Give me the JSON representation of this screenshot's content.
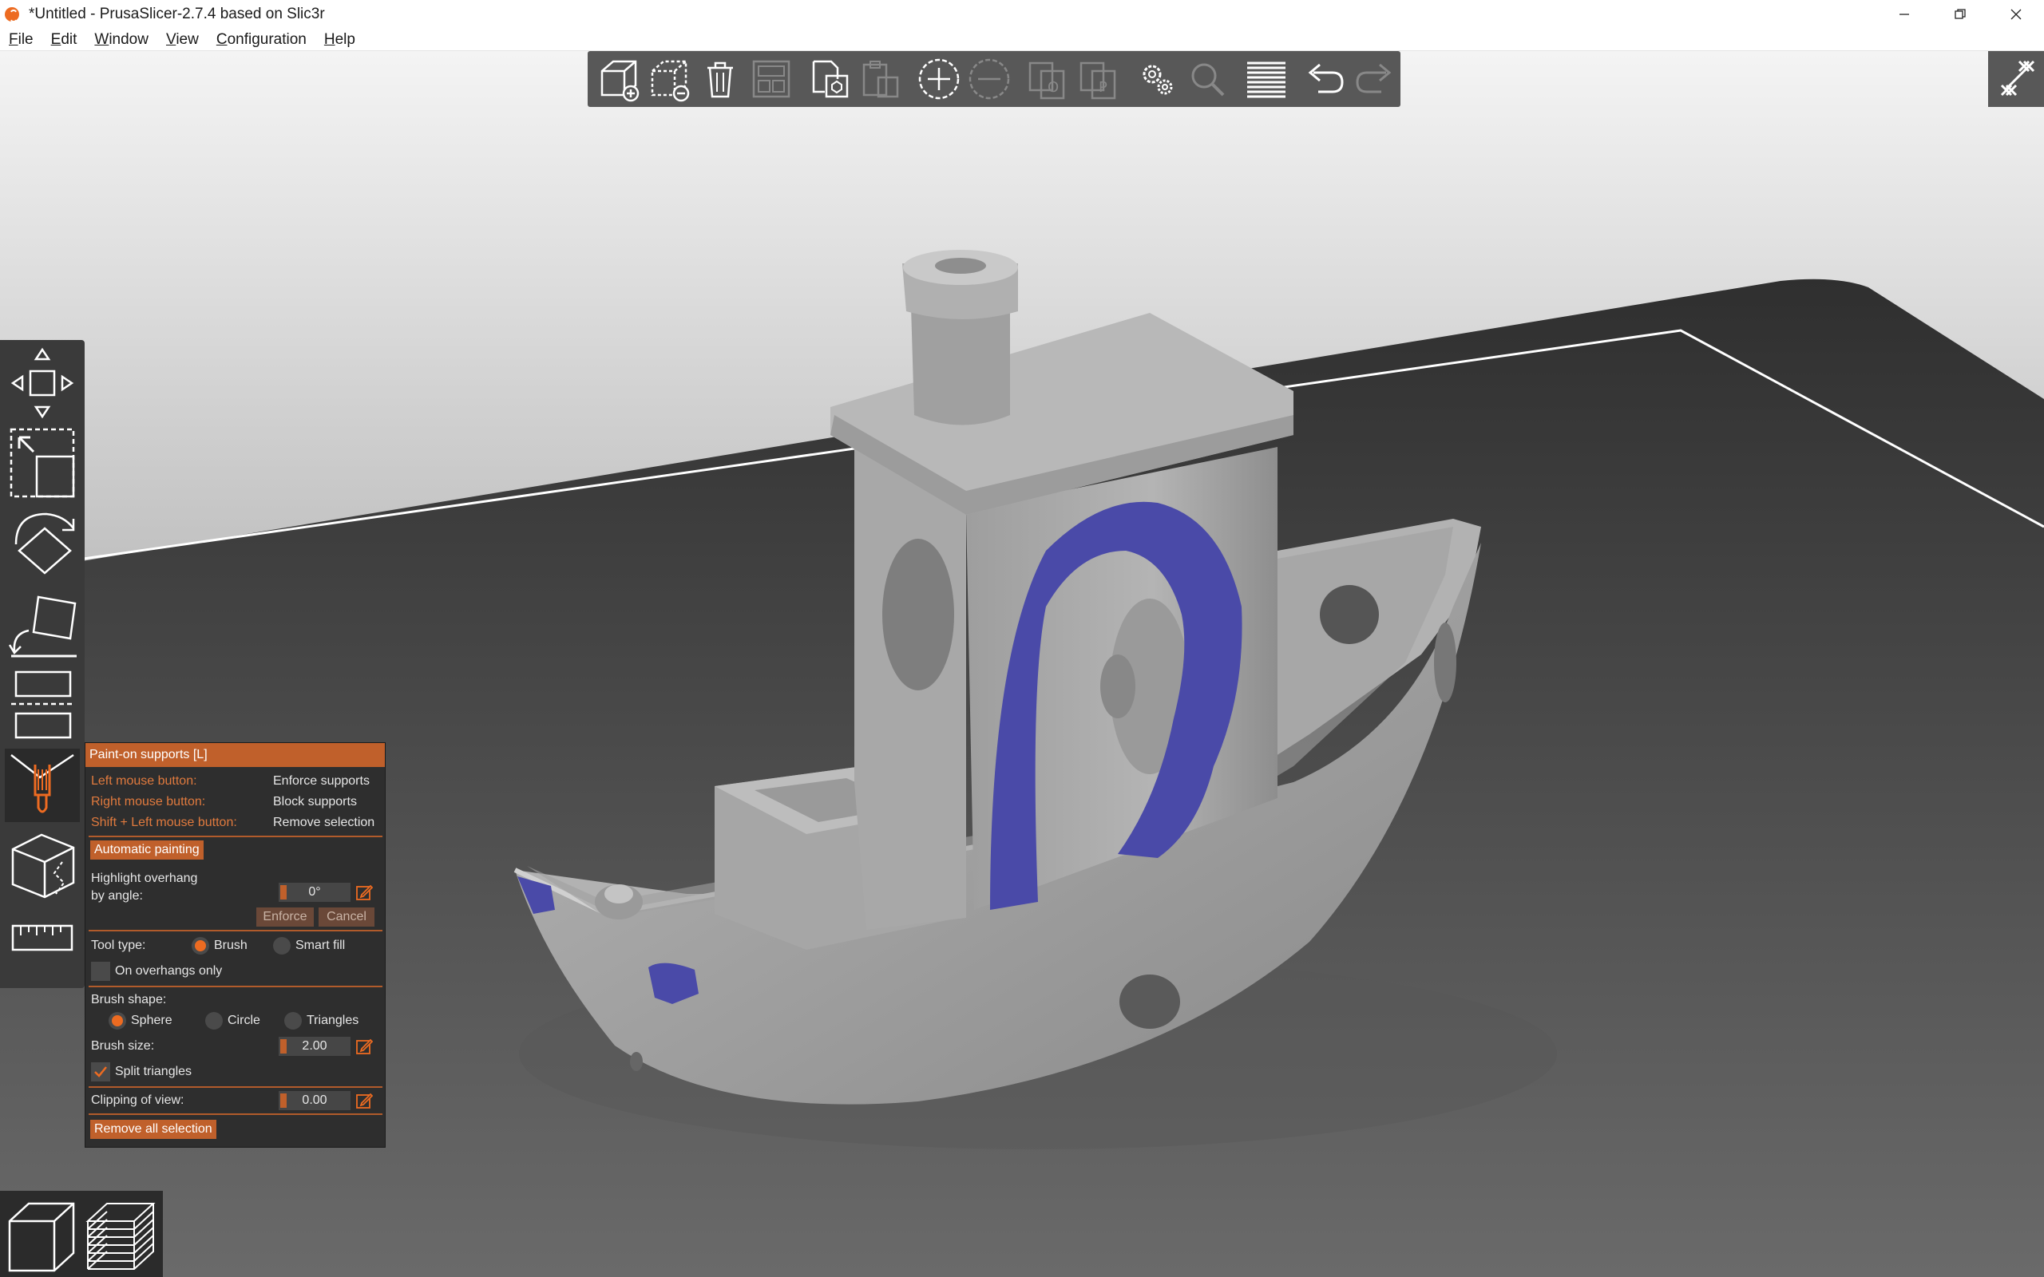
{
  "window": {
    "title": "*Untitled - PrusaSlicer-2.7.4 based on Slic3r"
  },
  "menu": [
    "File",
    "Edit",
    "Window",
    "View",
    "Configuration",
    "Help"
  ],
  "toolbar": {
    "buttons": [
      {
        "name": "add",
        "icon": "add-object-icon",
        "enabled": true
      },
      {
        "name": "delete",
        "icon": "delete-object-icon",
        "enabled": true
      },
      {
        "name": "delete-all",
        "icon": "trash-icon",
        "enabled": true
      },
      {
        "name": "arrange",
        "icon": "arrange-icon",
        "enabled": false
      },
      {
        "name": "copy",
        "icon": "copy-icon",
        "enabled": true
      },
      {
        "name": "paste",
        "icon": "paste-icon",
        "enabled": false
      },
      {
        "name": "add-instance",
        "icon": "add-instance-icon",
        "enabled": true
      },
      {
        "name": "remove-instance",
        "icon": "remove-instance-icon",
        "enabled": false
      },
      {
        "name": "split-objects",
        "icon": "split-objects-icon",
        "enabled": false
      },
      {
        "name": "split-parts",
        "icon": "split-parts-icon",
        "enabled": false
      },
      {
        "name": "settings",
        "icon": "settings-icon",
        "enabled": true
      },
      {
        "name": "search",
        "icon": "search-icon",
        "enabled": false
      },
      {
        "name": "layers",
        "icon": "layers-editing-icon",
        "enabled": true
      },
      {
        "name": "undo",
        "icon": "undo-icon",
        "enabled": true
      },
      {
        "name": "redo",
        "icon": "redo-icon",
        "enabled": false
      }
    ]
  },
  "panel": {
    "title": "Paint-on supports [L]",
    "left_mouse_label": "Left mouse button:",
    "left_mouse_value": "Enforce supports",
    "right_mouse_label": "Right mouse button:",
    "right_mouse_value": "Block supports",
    "shift_left_label": "Shift + Left mouse button:",
    "shift_left_value": "Remove selection",
    "auto_painting": "Automatic painting",
    "highlight_label_1": "Highlight overhang",
    "highlight_label_2": "by angle:",
    "highlight_value": "0°",
    "enforce": "Enforce",
    "cancel": "Cancel",
    "tool_type_label": "Tool type:",
    "tool_brush": "Brush",
    "tool_smart_fill": "Smart fill",
    "tool_selected": "Brush",
    "overhangs_only": "On overhangs only",
    "overhangs_only_checked": false,
    "brush_shape_label": "Brush shape:",
    "shape_sphere": "Sphere",
    "shape_circle": "Circle",
    "shape_triangles": "Triangles",
    "shape_selected": "Sphere",
    "brush_size_label": "Brush size:",
    "brush_size_value": "2.00",
    "split_triangles": "Split triangles",
    "split_triangles_checked": true,
    "clipping_label": "Clipping of view:",
    "clipping_value": "0.00",
    "remove_all": "Remove all selection"
  },
  "colors": {
    "accent": "#ed6b21",
    "panel_header": "#c0602b",
    "support_paint": "#4a4aa8",
    "model": "#a8a8a8",
    "bed": "#3a3a3a"
  }
}
